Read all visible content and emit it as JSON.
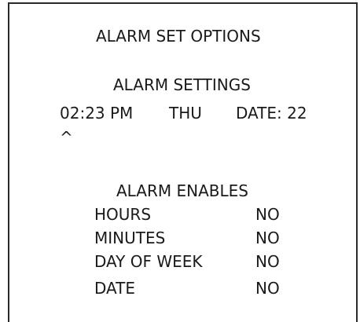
{
  "screen": {
    "title": "ALARM SET OPTIONS"
  },
  "settings": {
    "heading": "ALARM SETTINGS",
    "time": "02:23 PM",
    "day": "THU",
    "date": "DATE: 22",
    "cursor": "^"
  },
  "enables": {
    "heading": "ALARM ENABLES",
    "rows": [
      {
        "label": "HOURS",
        "value": "NO"
      },
      {
        "label": "MINUTES",
        "value": "NO"
      },
      {
        "label": "DAY OF WEEK",
        "value": "NO"
      },
      {
        "label": "DATE",
        "value": "NO"
      }
    ]
  }
}
